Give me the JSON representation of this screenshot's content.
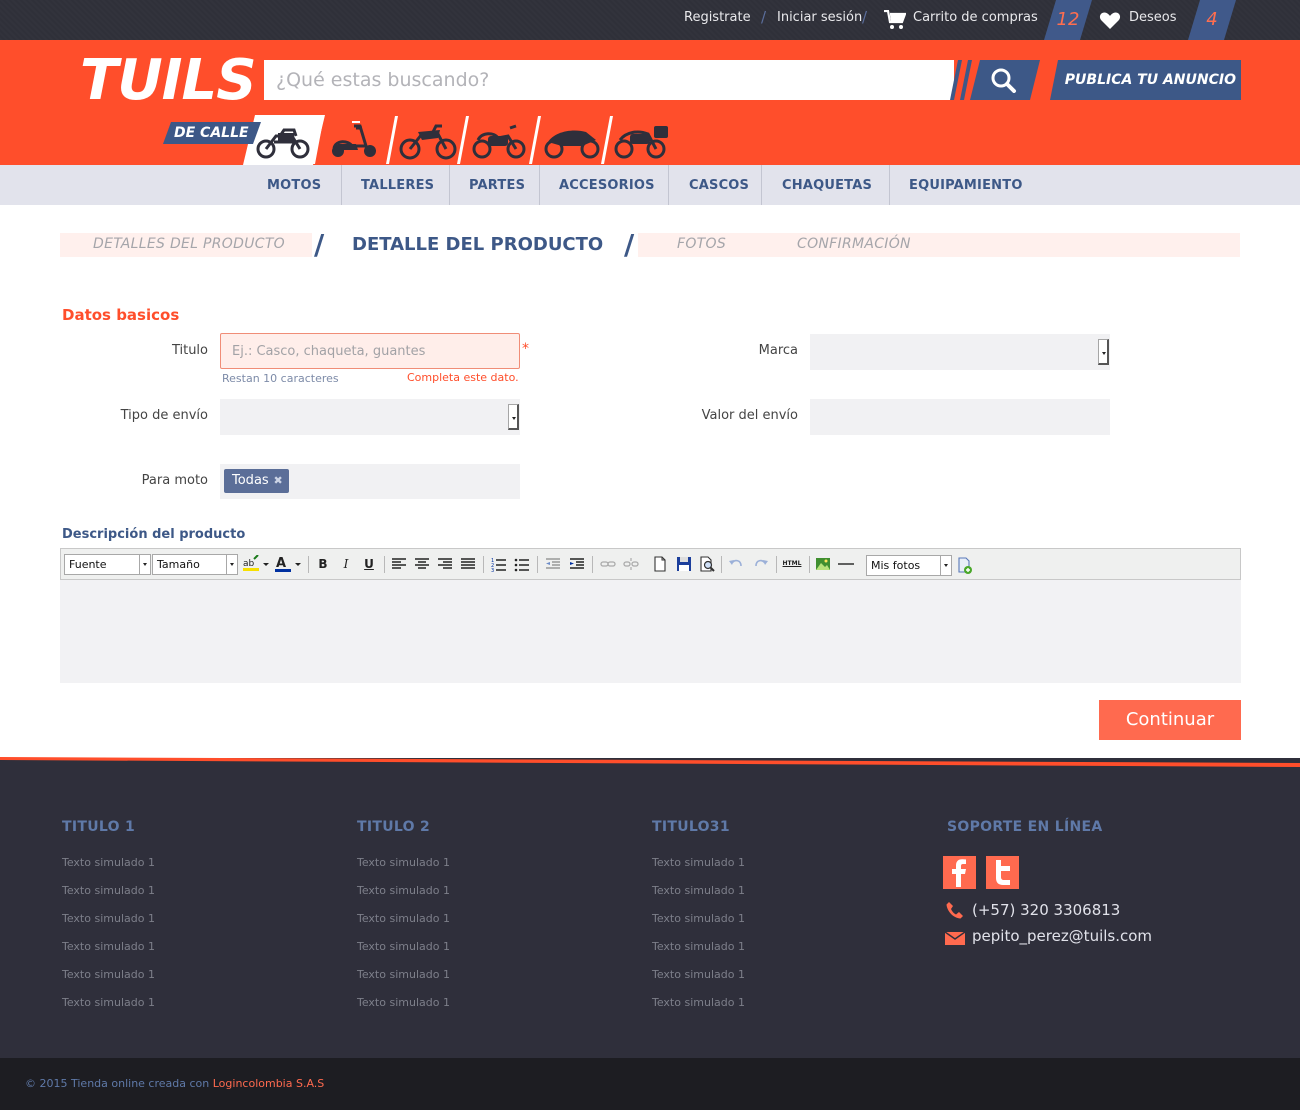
{
  "topbar": {
    "register": "Registrate",
    "login": "Iniciar sesión",
    "cart": "Carrito de compras",
    "cart_count": "12",
    "wishlist": "Deseos",
    "wishlist_count": "4",
    "separator": "/"
  },
  "header": {
    "logo": "TUILS",
    "search_placeholder": "¿Qué estas buscando?",
    "publish_button": "PUBLICA TU ANUNCIO",
    "active_category": "DE CALLE",
    "categories": [
      "street-motorcycle-icon",
      "scooter-icon",
      "dirt-bike-icon",
      "cruiser-icon",
      "sport-bike-icon",
      "touring-bike-icon"
    ]
  },
  "nav": {
    "items": [
      "MOTOS",
      "TALLERES",
      "PARTES",
      "ACCESORIOS",
      "CASCOS",
      "CHAQUETAS",
      "EQUIPAMIENTO"
    ]
  },
  "steps": {
    "step1": "DETALLES DEL PRODUCTO",
    "step2": "DETALLE DEL PRODUCTO",
    "step3": "FOTOS",
    "step4": "CONFIRMACIÓN"
  },
  "form": {
    "section_title": "Datos basicos",
    "titulo_label": "Titulo",
    "titulo_placeholder": "Ej.: Casco, chaqueta, guantes",
    "required_mark": "*",
    "hint": "Restan  10 caracteres",
    "error": "Completa este dato.",
    "marca_label": "Marca",
    "tipo_envio_label": "Tipo de envío",
    "valor_envio_label": "Valor del envío",
    "para_moto_label": "Para moto",
    "para_moto_tag": "Todas",
    "tag_remove": "✖"
  },
  "editor": {
    "title": "Descripción del producto",
    "font_select": "Fuente",
    "size_select": "Tamaño",
    "photos_select": "Mis fotos",
    "bold": "B",
    "italic": "I",
    "underline": "U",
    "html": "HTML"
  },
  "actions": {
    "continue": "Continuar"
  },
  "footer": {
    "columns": [
      {
        "title": "TITULO 1",
        "links": [
          "Texto simulado 1",
          "Texto simulado 1",
          "Texto simulado 1",
          "Texto simulado 1",
          "Texto simulado 1",
          "Texto simulado 1"
        ]
      },
      {
        "title": "TITULO 2",
        "links": [
          "Texto simulado 1",
          "Texto simulado 1",
          "Texto simulado 1",
          "Texto simulado 1",
          "Texto simulado 1",
          "Texto simulado 1"
        ]
      },
      {
        "title": "TITULO31",
        "links": [
          "Texto simulado 1",
          "Texto simulado 1",
          "Texto simulado 1",
          "Texto simulado 1",
          "Texto simulado 1",
          "Texto simulado 1"
        ]
      }
    ],
    "support_title": "SOPORTE EN LÍNEA",
    "phone": "(57) 320 3306813",
    "phone_display": "(+57) 320 3306813",
    "email": "pepito_perez@tuils.com",
    "copyright": "© 2015 Tienda online creada con ",
    "company": "Logincolombia S.A.S"
  },
  "colors": {
    "brand_orange": "#ff4e2b",
    "brand_blue": "#3d5887",
    "button_orange": "#ff6a4f",
    "footer_bg": "#2f2f3b"
  }
}
